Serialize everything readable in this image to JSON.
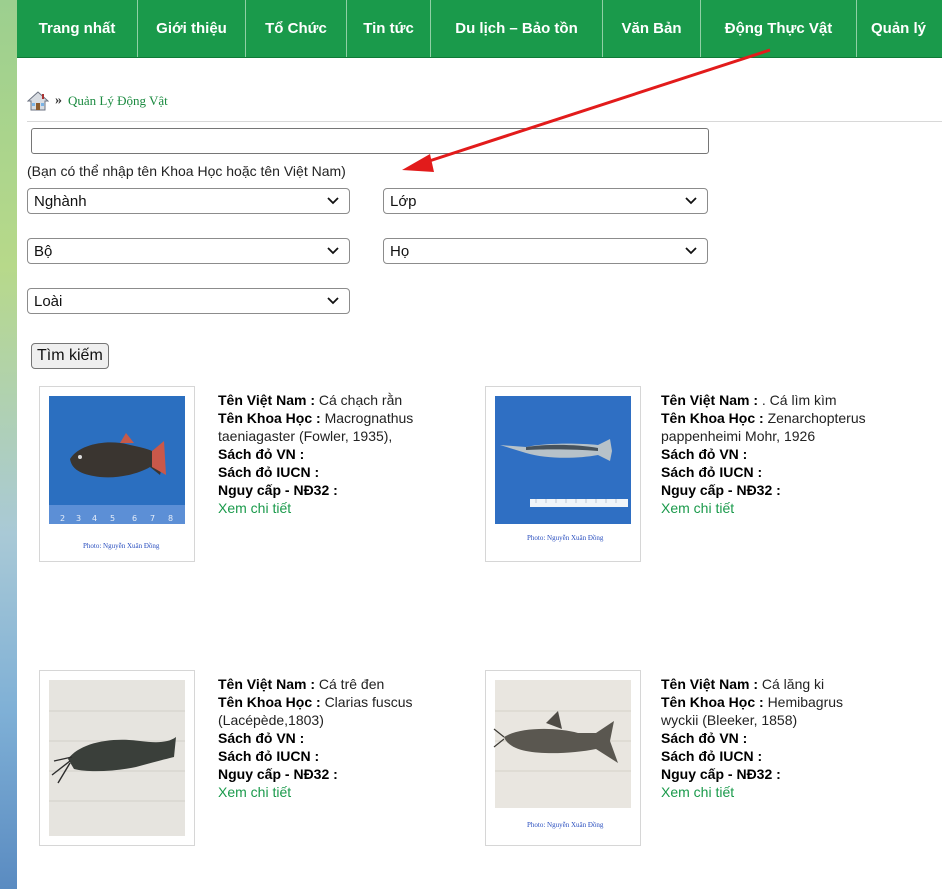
{
  "nav": {
    "items": [
      {
        "label": "Trang nhất"
      },
      {
        "label": "Giới thiệu"
      },
      {
        "label": "Tổ Chức"
      },
      {
        "label": "Tin tức"
      },
      {
        "label": "Du lịch – Bảo tồn"
      },
      {
        "label": "Văn Bản"
      },
      {
        "label": "Động Thực Vật"
      },
      {
        "label": "Quản lý"
      }
    ],
    "background": "#1a9a4b"
  },
  "breadcrumb": {
    "separator": "»",
    "current": "Quản Lý Động Vật"
  },
  "search": {
    "value": "",
    "hint": "(Bạn có thể nhập tên Khoa Học hoặc tên Việt Nam)",
    "button_label": "Tìm kiếm"
  },
  "filters": {
    "nganh": "Nghành",
    "lop": "Lớp",
    "bo": "Bộ",
    "ho": "Họ",
    "loai": "Loài"
  },
  "labels": {
    "ten_viet_nam": "Tên Việt Nam :",
    "ten_khoa_hoc": "Tên Khoa Học :",
    "sach_do_vn": "Sách đỏ VN :",
    "sach_do_iucn": "Sách đỏ IUCN :",
    "nguy_cap": "Nguy cấp - NĐ32 :",
    "xem_chi_tiet": "Xem chi tiết"
  },
  "species": [
    {
      "ten_viet_nam": "Cá chạch rằn",
      "ten_khoa_hoc_1": "Macrognathus",
      "ten_khoa_hoc_2": "taeniagaster (Fowler, 1935),",
      "photo_caption": "Photo: Nguyễn Xuân Đồng",
      "icon": "fish-photo-icon"
    },
    {
      "ten_viet_nam": ". Cá lìm kìm",
      "ten_khoa_hoc_1": "Zenarchopterus",
      "ten_khoa_hoc_2": "pappenheimi Mohr, 1926",
      "photo_caption": "Photo: Nguyễn Xuân Đồng",
      "icon": "fish-photo-icon"
    },
    {
      "ten_viet_nam": "Cá trê đen",
      "ten_khoa_hoc_1": "Clarias fuscus",
      "ten_khoa_hoc_2": "(Lacépède,1803)",
      "photo_caption": "",
      "icon": "fish-photo-icon"
    },
    {
      "ten_viet_nam": "Cá lăng ki",
      "ten_khoa_hoc_1": "Hemibagrus",
      "ten_khoa_hoc_2": "wyckii (Bleeker, 1858)",
      "photo_caption": "Photo: Nguyễn Xuân Đồng",
      "icon": "fish-photo-icon"
    }
  ],
  "colors": {
    "accent_green": "#1a9a4b",
    "annotation_red": "#e21b1b"
  }
}
